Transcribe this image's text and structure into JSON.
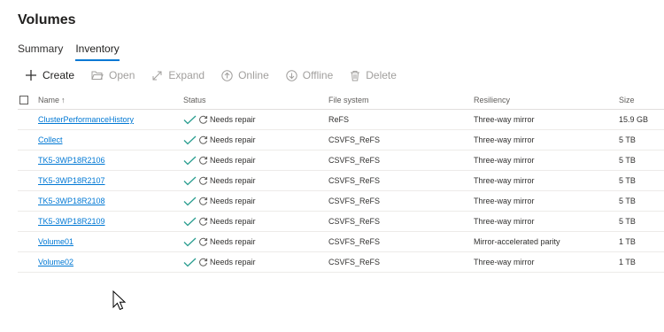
{
  "page": {
    "title": "Volumes"
  },
  "tabs": [
    {
      "label": "Summary",
      "active": false
    },
    {
      "label": "Inventory",
      "active": true
    }
  ],
  "toolbar": {
    "create": "Create",
    "open": "Open",
    "expand": "Expand",
    "online": "Online",
    "offline": "Offline",
    "delete": "Delete"
  },
  "columns": {
    "name": "Name",
    "name_sort_icon": "sort-ascending-icon",
    "status": "Status",
    "file_system": "File system",
    "resiliency": "Resiliency",
    "size": "Size"
  },
  "rows": [
    {
      "name": "ClusterPerformanceHistory",
      "status": "Needs repair",
      "file_system": "ReFS",
      "resiliency": "Three-way mirror",
      "size": "15.9 GB"
    },
    {
      "name": "Collect",
      "status": "Needs repair",
      "file_system": "CSVFS_ReFS",
      "resiliency": "Three-way mirror",
      "size": "5 TB"
    },
    {
      "name": "TK5-3WP18R2106",
      "status": "Needs repair",
      "file_system": "CSVFS_ReFS",
      "resiliency": "Three-way mirror",
      "size": "5 TB"
    },
    {
      "name": "TK5-3WP18R2107",
      "status": "Needs repair",
      "file_system": "CSVFS_ReFS",
      "resiliency": "Three-way mirror",
      "size": "5 TB"
    },
    {
      "name": "TK5-3WP18R2108",
      "status": "Needs repair",
      "file_system": "CSVFS_ReFS",
      "resiliency": "Three-way mirror",
      "size": "5 TB"
    },
    {
      "name": "TK5-3WP18R2109",
      "status": "Needs repair",
      "file_system": "CSVFS_ReFS",
      "resiliency": "Three-way mirror",
      "size": "5 TB"
    },
    {
      "name": "Volume01",
      "status": "Needs repair",
      "file_system": "CSVFS_ReFS",
      "resiliency": "Mirror-accelerated parity",
      "size": "1 TB"
    },
    {
      "name": "Volume02",
      "status": "Needs repair",
      "file_system": "CSVFS_ReFS",
      "resiliency": "Three-way mirror",
      "size": "1 TB"
    }
  ],
  "colors": {
    "accent": "#0078d4",
    "healthy_check": "#2a9d8f",
    "disabled_text": "#a19f9d"
  }
}
